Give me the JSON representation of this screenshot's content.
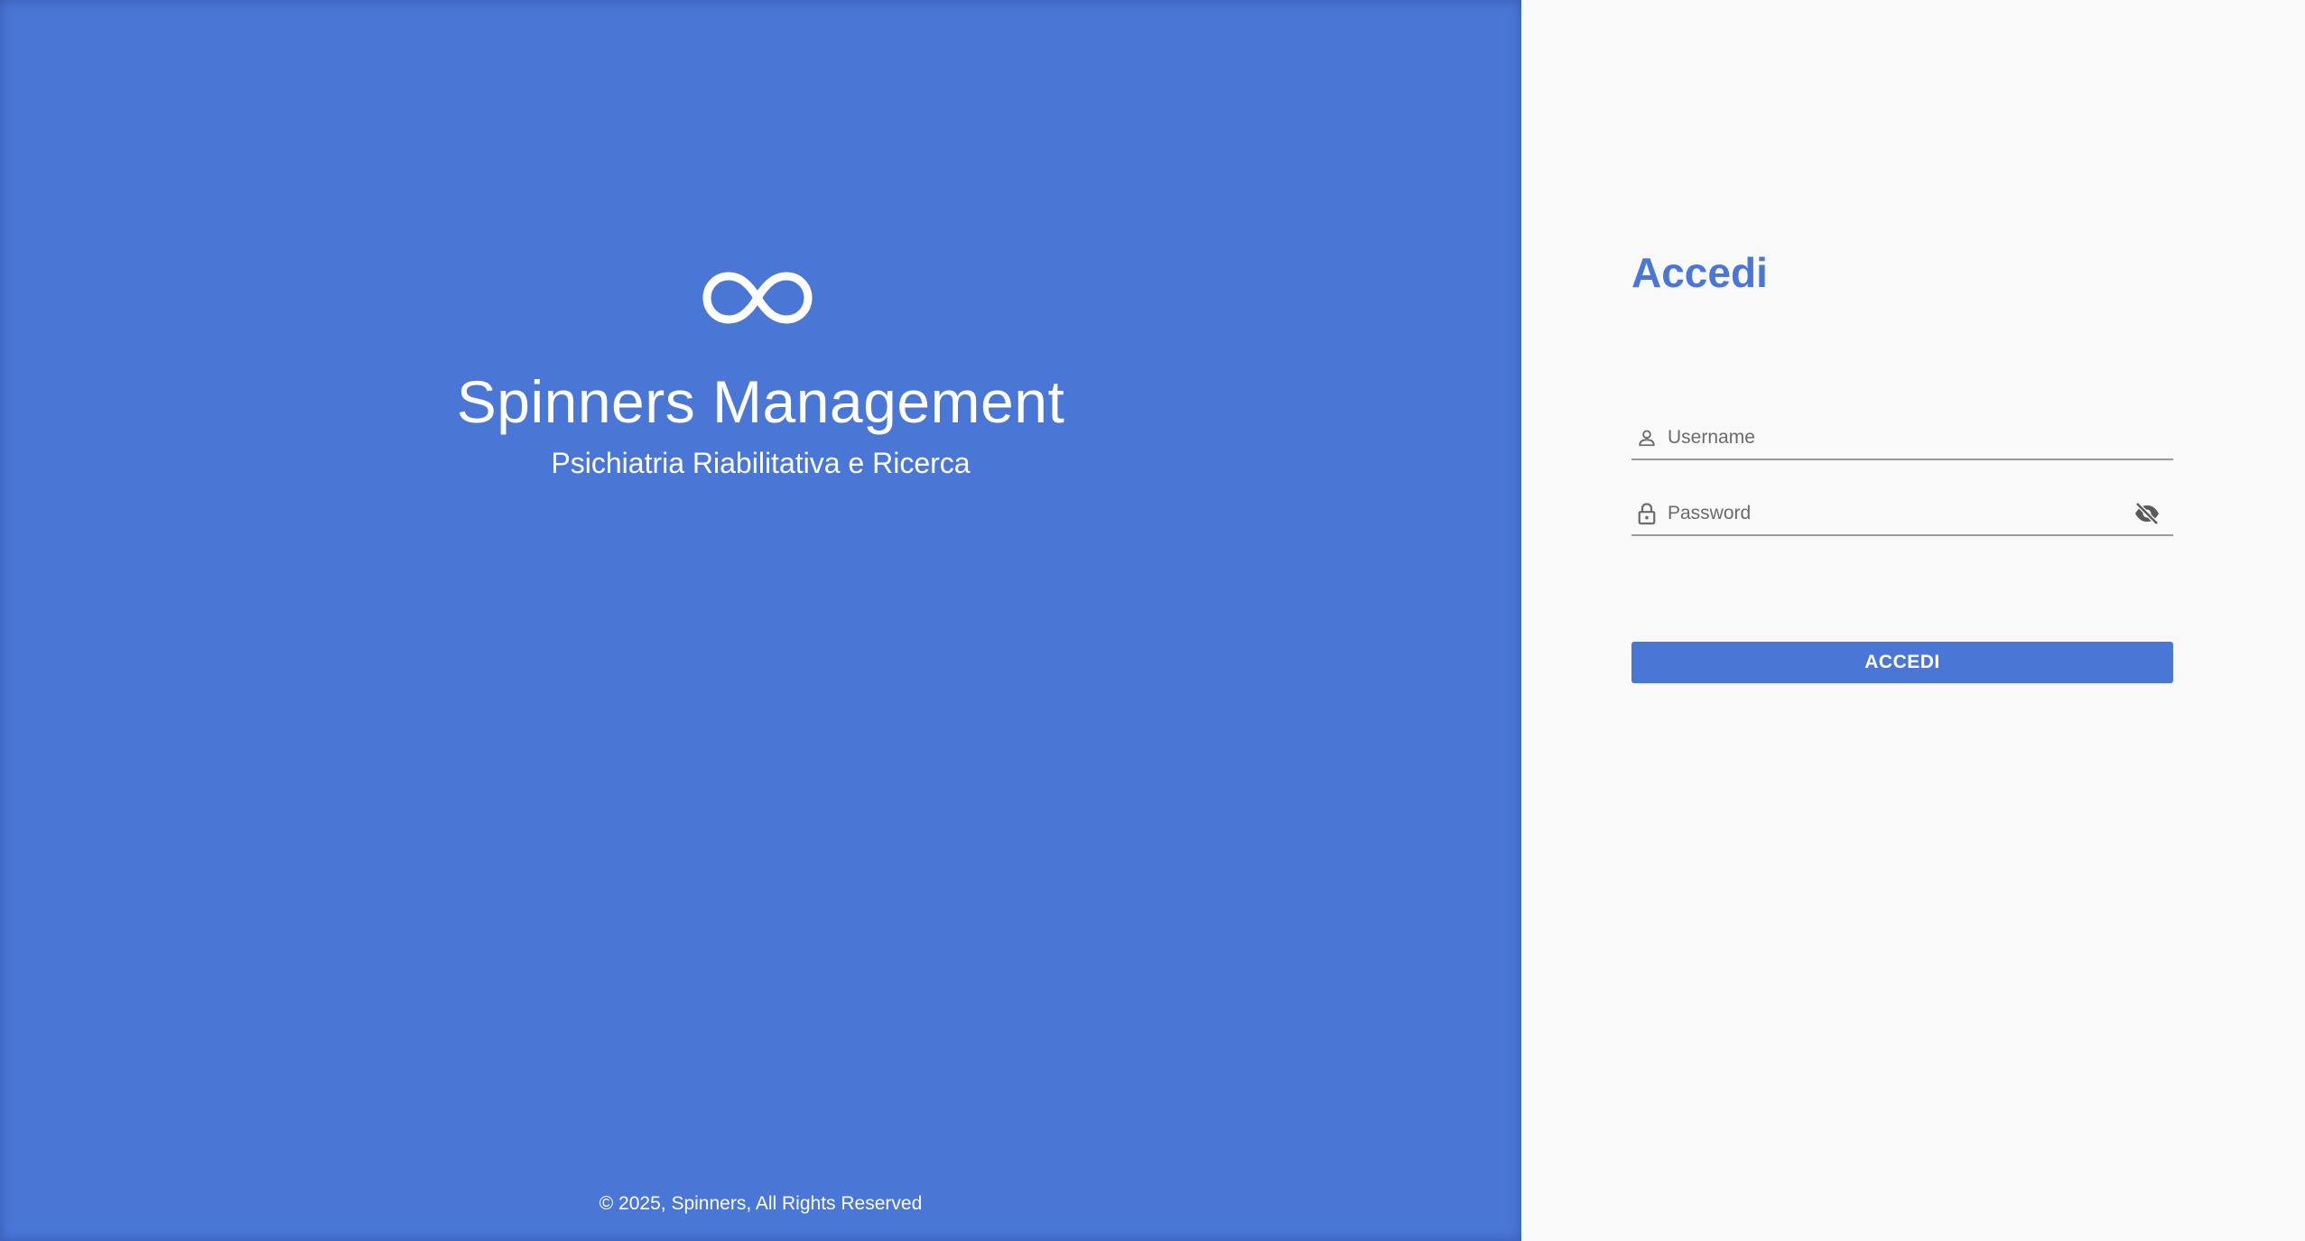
{
  "brand": {
    "logo_icon": "infinity-logo",
    "title": "Spinners Management",
    "subtitle": "Psichiatria Riabilitativa e Ricerca",
    "footer": "© 2025, Spinners, All Rights Reserved",
    "color": "#4a77d6"
  },
  "login": {
    "title": "Accedi",
    "username": {
      "icon": "user-icon",
      "placeholder": "Username",
      "value": ""
    },
    "password": {
      "icon": "lock-icon",
      "placeholder": "Password",
      "value": "",
      "toggle_icon": "eye-off-icon"
    },
    "submit_label": "ACCEDI",
    "accent_color": "#4a77d6",
    "background": "#f9f9f9"
  }
}
